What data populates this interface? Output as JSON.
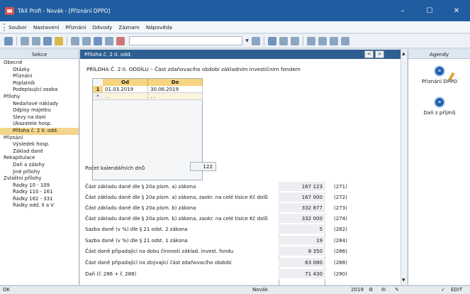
{
  "window": {
    "title": "TAX Profi - Novák - [Přiznání DPPO]",
    "minimize": "–",
    "maximize": "☐",
    "close": "✕"
  },
  "menu": [
    "Soubor",
    "Nastavení",
    "Přiznání",
    "Odvody",
    "Záznam",
    "Nápověda"
  ],
  "left_panel": {
    "header": "Sekce",
    "items": [
      {
        "label": "Obecné",
        "level": 0
      },
      {
        "label": "Otázky",
        "level": 1
      },
      {
        "label": "Přiznání",
        "level": 1
      },
      {
        "label": "Poplatník",
        "level": 1
      },
      {
        "label": "Podepisující osoba",
        "level": 1
      },
      {
        "label": "Přílohy",
        "level": 0
      },
      {
        "label": "Nedaňové náklady",
        "level": 1
      },
      {
        "label": "Odpisy majetku",
        "level": 1
      },
      {
        "label": "Slevy na dani",
        "level": 1
      },
      {
        "label": "Ukazatele hosp.",
        "level": 1
      },
      {
        "label": "Příloha č. 2 II. odd.",
        "level": 1,
        "selected": true
      },
      {
        "label": "Přiznání",
        "level": 0
      },
      {
        "label": "Výsledek hosp.",
        "level": 1
      },
      {
        "label": "Základ daně",
        "level": 1
      },
      {
        "label": "Rekapitulace",
        "level": 0
      },
      {
        "label": "Daň a zálohy",
        "level": 1
      },
      {
        "label": "Jiné přílohy",
        "level": 1
      },
      {
        "label": "Zvláštní přílohy",
        "level": 0
      },
      {
        "label": "Řádky 10 - 109",
        "level": 1
      },
      {
        "label": "Řádky 110 - 161",
        "level": 1
      },
      {
        "label": "Řádky 162 - 331",
        "level": 1
      },
      {
        "label": "Řádky odd. II a V",
        "level": 1
      }
    ]
  },
  "main": {
    "header": "Příloha č. 2 II. odd.",
    "prev": "<",
    "next": ">",
    "page_title": "PŘÍLOHA Č. 2 II. ODDÍLU – Část zdaňovacího období základním investičním fondem",
    "grid": {
      "columns": [
        "Od",
        "Do"
      ],
      "rows": [
        {
          "num": "1",
          "od": "01.03.2019",
          "do": "30.06.2019"
        },
        {
          "num": "*",
          "od": ". .",
          "do": ". ."
        }
      ]
    },
    "pocet_label": "Počet kalendářních dnů",
    "pocet_value": "122",
    "summary": [
      {
        "label": "Část základu daně dle § 20a písm. a) zákona",
        "value": "167 123",
        "code": "(271)"
      },
      {
        "label": "Část základu daně dle § 20a písm. a) zákona, zaokr. na celé tisíce Kč dolů",
        "value": "167 000",
        "code": "(272)"
      },
      {
        "label": "Část základu daně dle § 20a písm. b) zákona",
        "value": "332 877",
        "code": "(273)"
      },
      {
        "label": "Část základu daně dle § 20a písm. b) zákona, zaokr. na celé tisíce Kč dolů",
        "value": "332 000",
        "code": "(274)"
      },
      {
        "label": "Sazba daně (v %) dle § 21 odst. 2 zákona",
        "value": "5",
        "code": "(282)"
      },
      {
        "label": "Sazba daně (v %) dle § 21 odst. 1 zákona",
        "value": "19",
        "code": "(284)"
      },
      {
        "label": "Část daně připadající na dobu činnosti základ. invest. fondu",
        "value": "8 350",
        "code": "(286)"
      },
      {
        "label": "Část daně připadající na zbývající část zdaňovacího období",
        "value": "63 080",
        "code": "(288)"
      },
      {
        "label": "Daň (ř. 286 + ř. 288)",
        "value": "71 430",
        "code": "(290)"
      }
    ]
  },
  "right_panel": {
    "header": "Agendy",
    "items": [
      "Přiznání DPPO",
      "Daň z příjmů"
    ]
  },
  "status": {
    "left": "OK",
    "user": "Novák",
    "year": "2019",
    "mode": "EDIT"
  }
}
